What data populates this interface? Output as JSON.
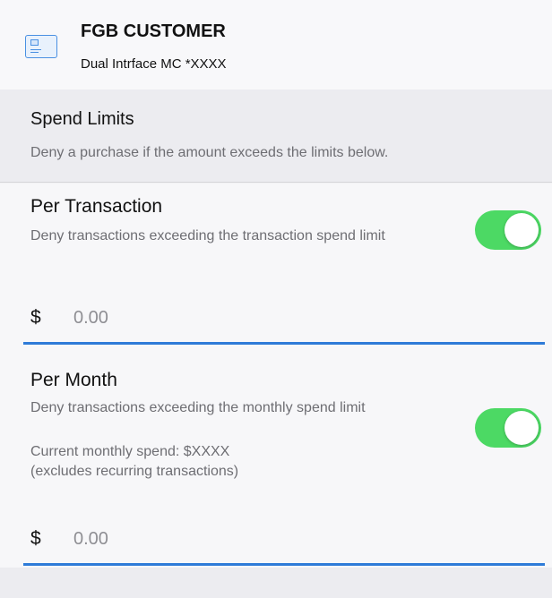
{
  "card": {
    "icon": "credit-card-icon",
    "title": "FGB CUSTOMER",
    "subtitle": "Dual Intrface MC *XXXX"
  },
  "spend_limits": {
    "title": "Spend Limits",
    "description": "Deny a purchase if the amount exceeds the limits below."
  },
  "per_transaction": {
    "title": "Per Transaction",
    "description": "Deny transactions exceeding the transaction spend limit",
    "enabled": true,
    "currency_symbol": "$",
    "placeholder": "0.00"
  },
  "per_month": {
    "title": "Per Month",
    "description": "Deny transactions exceeding the monthly spend limit",
    "current_spend": "Current monthly spend: $XXXX",
    "note": "(excludes recurring transactions)",
    "enabled": true,
    "currency_symbol": "$",
    "placeholder": "0.00"
  },
  "colors": {
    "toggle_on": "#4cd964",
    "input_underline": "#2e7bd8"
  }
}
